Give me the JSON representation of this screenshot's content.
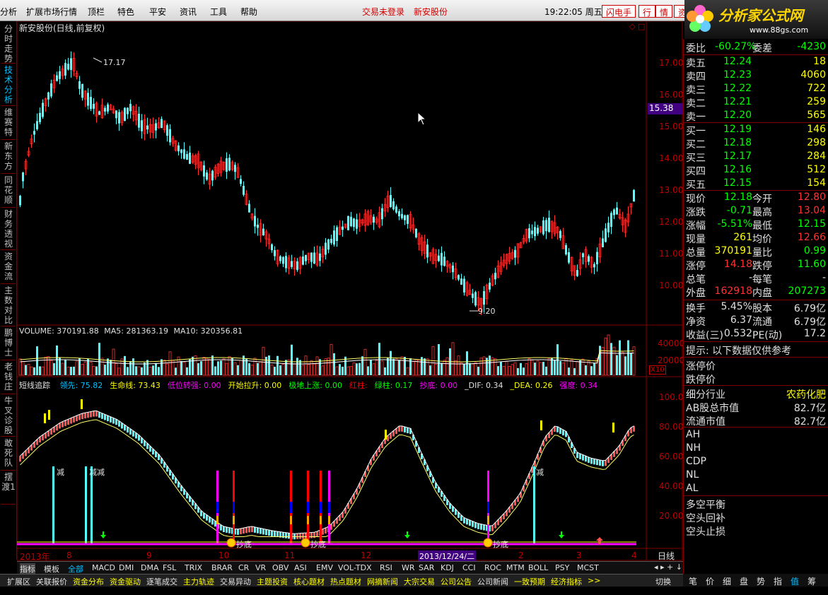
{
  "menu": {
    "items": [
      "分析",
      "扩展市场行情",
      "顶栏",
      "特色",
      "平安",
      "资讯",
      "工具",
      "帮助"
    ],
    "trade_login": "交易未登录",
    "stock_name_link": "新安股份",
    "clock": "19:22:05 周五",
    "flash_btn": "闪电手",
    "quote_btn": "行",
    "info_btn": "情",
    "extra_btn": "资"
  },
  "logo": {
    "title": "分析家公式网",
    "url": "www.88gs.com"
  },
  "left_tabs": [
    "分时走势",
    "技术分析",
    "维赛特",
    "新东方",
    "同花顺",
    "财务透视",
    "资金流",
    "主数对比",
    "鹏博士",
    "老钱庄",
    "牛叉诊股",
    "敢死队",
    "摆渡1"
  ],
  "main_chart": {
    "title": "新安股份(日线,前复权)",
    "current_price_label": "15.38",
    "high_label": "17.17",
    "low_label": "9.20",
    "price_axis": [
      "17.00",
      "16.00",
      "15.00",
      "14.00",
      "13.00",
      "12.00",
      "11.00",
      "10.00"
    ]
  },
  "volume": {
    "title": "VOLUME: 370191.88",
    "ma5": "MA5: 281363.19",
    "ma10": "MA10: 320356.81",
    "axis": [
      "40000",
      "20000"
    ],
    "unit": "X10"
  },
  "indicator": {
    "name": "短线追踪",
    "items": [
      {
        "label": "领先: 75.82",
        "color": "#00c0ff"
      },
      {
        "label": "生命线: 73.43",
        "color": "#ffff00"
      },
      {
        "label": "低位转强: 0.00",
        "color": "#ff00ff"
      },
      {
        "label": "开始拉升: 0.00",
        "color": "#ffff00"
      },
      {
        "label": "极地上涨: 0.00",
        "color": "#00ff00"
      },
      {
        "label": "红柱:",
        "color": "#ff0000"
      },
      {
        "label": "绿柱: 0.17",
        "color": "#00ff00"
      },
      {
        "label": "抄底: 0.00",
        "color": "#ff00ff"
      },
      {
        "label": "_DIF: 0.34",
        "color": "#e0e0e0"
      },
      {
        "label": "_DEA: 0.26",
        "color": "#ffff00"
      },
      {
        "label": "强度: 0.34",
        "color": "#ff00ff"
      }
    ],
    "axis": [
      "100.00",
      "80.00",
      "60.00",
      "40.00",
      "20.00"
    ],
    "annotations": [
      "减",
      "减减",
      "减"
    ],
    "bottom_marks": [
      "抄底",
      "抄底",
      "抄底"
    ]
  },
  "date_axis": {
    "labels": [
      "2013年",
      "8",
      "9",
      "10",
      "11",
      "12",
      "2013/12/24/二",
      "2",
      "3",
      "4"
    ],
    "period": "日线"
  },
  "quote": {
    "ratio_label": "委比",
    "ratio_value": "-60.27%",
    "diff_label": "委差",
    "diff_value": "-4230",
    "asks": [
      {
        "label": "卖五",
        "price": "12.24",
        "vol": "18"
      },
      {
        "label": "卖四",
        "price": "12.23",
        "vol": "4060"
      },
      {
        "label": "卖三",
        "price": "12.22",
        "vol": "722"
      },
      {
        "label": "卖二",
        "price": "12.21",
        "vol": "259"
      },
      {
        "label": "卖一",
        "price": "12.20",
        "vol": "565"
      }
    ],
    "bids": [
      {
        "label": "买一",
        "price": "12.19",
        "vol": "146"
      },
      {
        "label": "买二",
        "price": "12.18",
        "vol": "298"
      },
      {
        "label": "买三",
        "price": "12.17",
        "vol": "284"
      },
      {
        "label": "买四",
        "price": "12.16",
        "vol": "512"
      },
      {
        "label": "买五",
        "price": "12.15",
        "vol": "154"
      }
    ],
    "stats": [
      {
        "l1": "现价",
        "v1": "12.18",
        "c1": "grn",
        "l2": "今开",
        "v2": "12.80",
        "c2": "red2"
      },
      {
        "l1": "涨跌",
        "v1": "-0.71",
        "c1": "grn",
        "l2": "最高",
        "v2": "13.04",
        "c2": "red2"
      },
      {
        "l1": "涨幅",
        "v1": "-5.51%",
        "c1": "grn",
        "l2": "最低",
        "v2": "12.15",
        "c2": "grn"
      },
      {
        "l1": "现量",
        "v1": "261",
        "c1": "yel",
        "l2": "均价",
        "v2": "12.66",
        "c2": "red2"
      },
      {
        "l1": "总量",
        "v1": "370191",
        "c1": "yel",
        "l2": "量比",
        "v2": "0.99",
        "c2": "grn"
      },
      {
        "l1": "涨停",
        "v1": "14.18",
        "c1": "red2",
        "l2": "跌停",
        "v2": "11.60",
        "c2": "grn"
      },
      {
        "l1": "总笔",
        "v1": "-",
        "c1": "wht",
        "l2": "每笔",
        "v2": "-",
        "c2": "wht"
      },
      {
        "l1": "外盘",
        "v1": "162918",
        "c1": "red2",
        "l2": "内盘",
        "v2": "207273",
        "c2": "grn"
      }
    ],
    "fund": [
      {
        "l1": "换手",
        "v1": "5.45%",
        "l2": "股本",
        "v2": "6.79亿"
      },
      {
        "l1": "净资",
        "v1": "6.37",
        "l2": "流通",
        "v2": "6.79亿"
      },
      {
        "l1": "收益(三)",
        "v1": "0.532",
        "l2": "PE(动)",
        "v2": "17.2"
      }
    ],
    "hint": "提示: 以下数据仅供参考",
    "limit_up": "涨停价",
    "limit_down": "跌停价",
    "industry_label": "细分行业",
    "industry_value": "农药化肥",
    "ab_label": "AB股总市值",
    "ab_value": "82.7亿",
    "float_label": "流通市值",
    "float_value": "82.7亿",
    "codes": [
      "AH",
      "NH",
      "CDP",
      "NL",
      "AL"
    ],
    "signals": [
      "多空平衡",
      "空头回补",
      "空头止损"
    ]
  },
  "indicator_tabs": [
    "指标",
    "模板",
    "全部",
    "MACD",
    "DMI",
    "DMA",
    "FSL",
    "TRIX",
    "BRAR",
    "CR",
    "VR",
    "OBV",
    "ASI",
    "EMV",
    "VOL-TDX",
    "RSI",
    "WR",
    "SAR",
    "KDJ",
    "CCI",
    "ROC",
    "MTM",
    "BOLL",
    "PSY",
    "MCST"
  ],
  "bottom_tabs": [
    "扩展区",
    "关联报价",
    "资金分布",
    "资金驱动",
    "逐笔成交",
    "主力轨迹",
    "交易异动",
    "主题投资",
    "核心题材",
    "热点题材",
    "网摘新闻",
    "大宗交易",
    "公司公告",
    "公司新闻",
    "一致预期",
    "经济指标",
    ">>",
    "切换"
  ],
  "right_tabs": [
    "笔",
    "价",
    "细",
    "盘",
    "势",
    "指",
    "值",
    "筹"
  ]
}
